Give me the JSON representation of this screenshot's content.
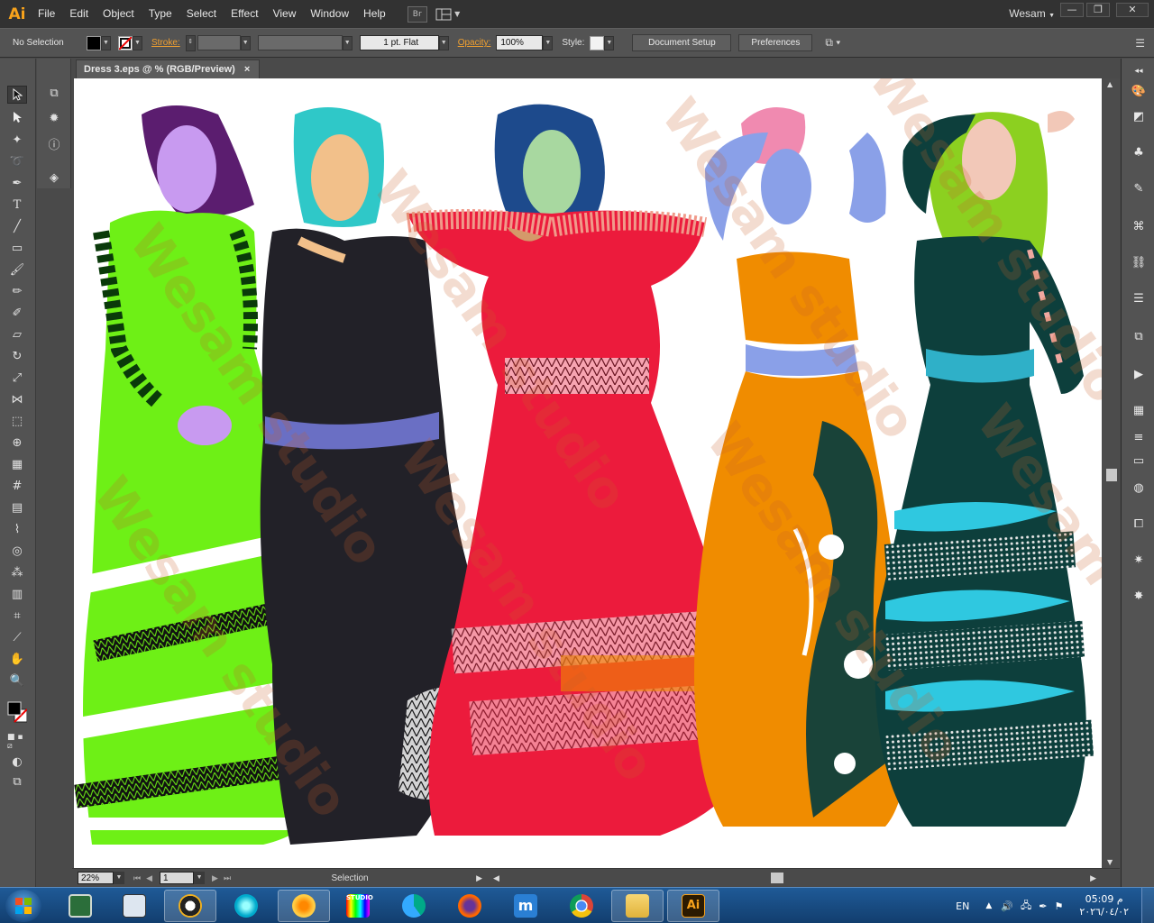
{
  "app": {
    "logo": "Ai",
    "menus": [
      "File",
      "Edit",
      "Object",
      "Type",
      "Select",
      "Effect",
      "View",
      "Window",
      "Help"
    ],
    "bridge_label": "Br",
    "workspace": "Wesam",
    "window_controls": {
      "minimize": "—",
      "restore": "❐",
      "close": "✕"
    }
  },
  "control_bar": {
    "selection_state": "No Selection",
    "fill_color": "#000000",
    "stroke_label": "Stroke:",
    "stroke_style": "1 pt. Flat",
    "opacity_label": "Opacity:",
    "opacity_value": "100%",
    "style_label": "Style:",
    "document_setup": "Document Setup",
    "preferences": "Preferences"
  },
  "document": {
    "tab_title": "Dress 3.eps @ % (RGB/Preview)",
    "tab_close": "×",
    "watermark": "Wesam studio"
  },
  "status_bar": {
    "zoom": "22%",
    "artboard_number": "1",
    "current_tool": "Selection"
  },
  "taskbar": {
    "apps": [
      "terminal",
      "sketch",
      "tux",
      "media-player",
      "paint",
      "studio",
      "edge",
      "firefox",
      "maxthon",
      "chrome",
      "explorer",
      "illustrator"
    ],
    "illustrator_label": "Ai",
    "studio_label": "STUDIO",
    "language": "EN",
    "time": "05:09 م",
    "date": "٢٠٢٦/٠٤/٠٢"
  },
  "colors": {
    "accent": "#f7a21b",
    "dress_green": "#6ef016",
    "dress_black": "#222128",
    "dress_red": "#ec1b3c",
    "dress_orange": "#f08c00",
    "dress_teal": "#0d3f3c"
  }
}
